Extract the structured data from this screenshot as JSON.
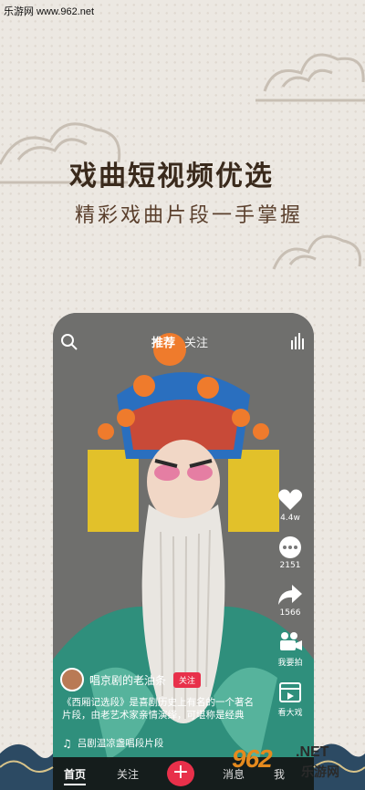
{
  "watermark": "乐游网 www.962.net",
  "headline": "戏曲短视频优选",
  "subline": "精彩戏曲片段一手掌握",
  "topbar": {
    "tab_recommend": "推荐",
    "tab_follow": "关注"
  },
  "rail": {
    "likes": "4.4w",
    "comments": "2151",
    "shares": "1566",
    "sing": "我要拍",
    "watch": "看大戏"
  },
  "post": {
    "username": "唱京剧的老油条",
    "follow_label": "关注",
    "description": "《西厢记选段》是喜剧历史上有名的一个著名片段，由老艺术家亲情演绎，可堪称是经典",
    "music": "吕剧温凉盏唱段片段"
  },
  "tabbar": {
    "home": "首页",
    "follow": "关注",
    "plus": "+",
    "messages": "消息",
    "me": "我"
  },
  "logo": {
    "number": "962",
    "net": ".NET",
    "cn": "乐游网"
  },
  "colors": {
    "accent": "#e8304a",
    "headline": "#3a2a1c",
    "background": "#ece8e2",
    "logo_orange": "#e58a1e"
  }
}
